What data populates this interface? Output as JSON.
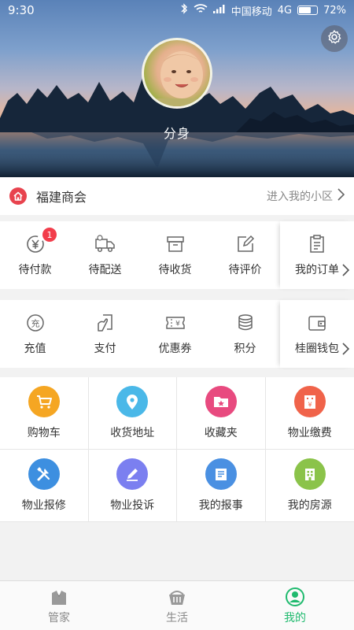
{
  "status_bar": {
    "time": "9:30",
    "carrier": "中国移动",
    "network": "4G",
    "battery": "72%",
    "battery_level": 0.72
  },
  "profile": {
    "name": "分身"
  },
  "community": {
    "name": "福建商会",
    "enter_label": "进入我的小区"
  },
  "orders": {
    "items": [
      {
        "label": "待付款",
        "icon": "wallet-yen-icon",
        "badge": "1"
      },
      {
        "label": "待配送",
        "icon": "truck-icon"
      },
      {
        "label": "待收货",
        "icon": "box-icon"
      },
      {
        "label": "待评价",
        "icon": "edit-icon"
      }
    ],
    "more": {
      "label": "我的订单",
      "icon": "clipboard-icon"
    }
  },
  "wallet": {
    "items": [
      {
        "label": "充值",
        "icon": "recharge-icon"
      },
      {
        "label": "支付",
        "icon": "pay-icon"
      },
      {
        "label": "优惠券",
        "icon": "coupon-icon"
      },
      {
        "label": "积分",
        "icon": "coins-icon"
      }
    ],
    "more": {
      "label": "桂圈钱包",
      "icon": "purse-icon"
    }
  },
  "services": [
    {
      "label": "购物车",
      "icon": "cart-icon",
      "color": "#f5a623"
    },
    {
      "label": "收货地址",
      "icon": "location-icon",
      "color": "#4ab8e8"
    },
    {
      "label": "收藏夹",
      "icon": "folder-star-icon",
      "color": "#e84a7f"
    },
    {
      "label": "物业缴费",
      "icon": "building-fee-icon",
      "color": "#f0634a"
    },
    {
      "label": "物业报修",
      "icon": "tools-icon",
      "color": "#3d8fe0"
    },
    {
      "label": "物业投诉",
      "icon": "pen-icon",
      "color": "#7b7ff0"
    },
    {
      "label": "我的报事",
      "icon": "newspaper-icon",
      "color": "#4a90e2"
    },
    {
      "label": "我的房源",
      "icon": "house-icon",
      "color": "#8bc34a"
    }
  ],
  "bottom_nav": [
    {
      "label": "管家",
      "icon": "butler-icon",
      "active": false
    },
    {
      "label": "生活",
      "icon": "basket-icon",
      "active": false
    },
    {
      "label": "我的",
      "icon": "user-icon",
      "active": true
    }
  ],
  "colors": {
    "accent": "#1fba6e",
    "badge": "#f23d4b",
    "home_icon": "#e8434e"
  }
}
